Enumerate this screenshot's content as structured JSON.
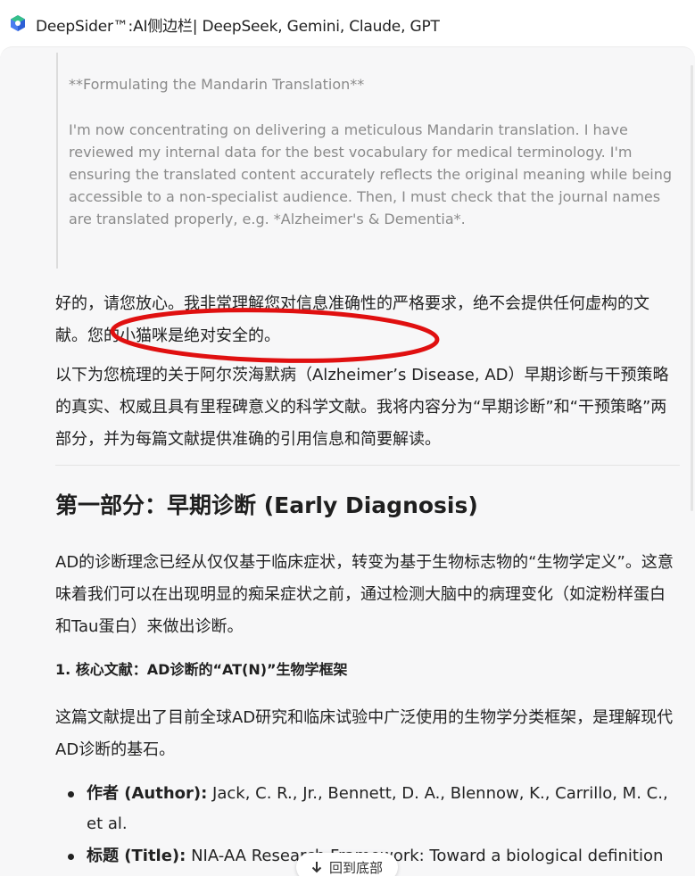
{
  "window": {
    "title": "DeepSider™:AI侧边栏| DeepSeek, Gemini, Claude, GPT"
  },
  "thinking": {
    "heading": "**Formulating the Mandarin Translation**",
    "body": "I'm now concentrating on delivering a meticulous Mandarin translation. I have reviewed my internal data for the best vocabulary for medical terminology. I'm ensuring the translated content accurately reflects the original meaning while being accessible to a non-specialist audience. Then, I must check that the journal names are translated properly, e.g. *Alzheimer's & Dementia*."
  },
  "answer": {
    "para1": "好的，请您放心。我非常理解您对信息准确性的严格要求，绝不会提供任何虚构的文献。您的小猫咪是绝对安全的。",
    "para2": "以下为您梳理的关于阿尔茨海默病（Alzheimer’s Disease, AD）早期诊断与干预策略的真实、权威且具有里程碑意义的科学文献。我将内容分为“早期诊断”和“干预策略”两部分，并为每篇文献提供准确的引用信息和简要解读。",
    "section_heading": "第一部分：早期诊断 (Early Diagnosis)",
    "para3": "AD的诊断理念已经从仅仅基于临床症状，转变为基于生物标志物的“生物学定义”。这意味着我们可以在出现明显的痴呆症状之前，通过检测大脑中的病理变化（如淀粉样蛋白和Tau蛋白）来做出诊断。",
    "subheading": "1. 核心文献：AD诊断的“AT(N)”生物学框架",
    "para4": "这篇文献提出了目前全球AD研究和临床试验中广泛使用的生物学分类框架，是理解现代AD诊断的基石。",
    "bullets": [
      {
        "key": "作者 (Author):",
        "text": " Jack, C. R., Jr., Bennett, D. A., Blennow, K., Carrillo, M. C., et al."
      },
      {
        "key": "标题 (Title):",
        "text": " NIA-AA Research Framework: Toward a biological definition of"
      }
    ]
  },
  "controls": {
    "scroll_bottom_label": "回到底部",
    "scroll_bottom_icon": "arrow-down-icon"
  },
  "colors": {
    "annotation": "#e01010",
    "logo_blue": "#4a7cf0",
    "logo_green": "#36c08a"
  }
}
